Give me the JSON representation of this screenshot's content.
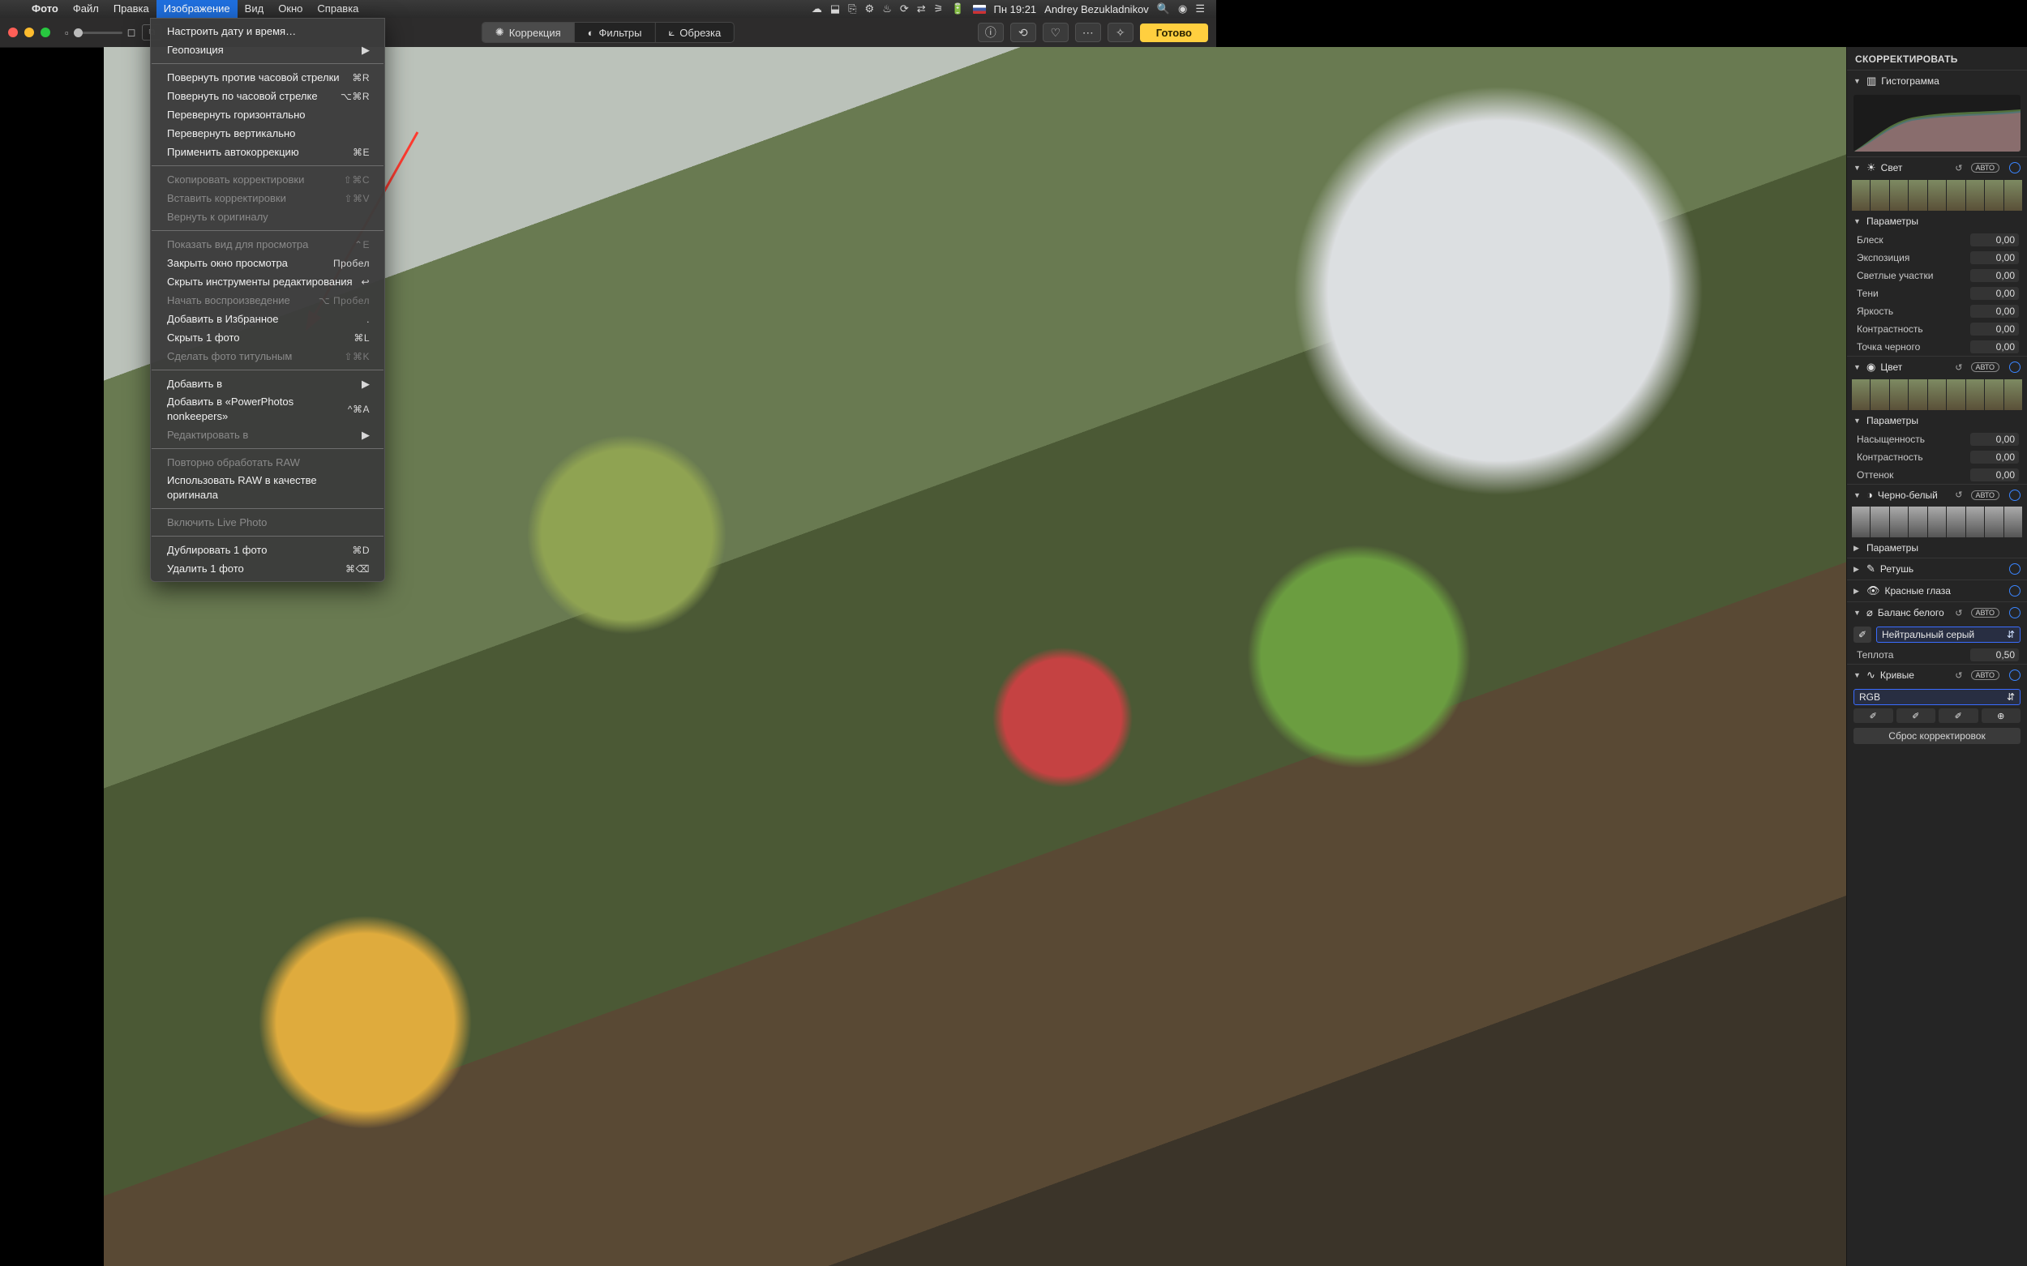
{
  "menubar": {
    "app": "Фото",
    "items": [
      "Файл",
      "Правка",
      "Изображение",
      "Вид",
      "Окно",
      "Справка"
    ],
    "active_index": 2,
    "time": "Пн 19:21",
    "user": "Andrey Bezukladnikov"
  },
  "toolbar": {
    "segments": {
      "adjust": "Коррекция",
      "filters": "Фильтры",
      "crop": "Обрезка"
    },
    "done": "Готово"
  },
  "dropdown": {
    "groups": [
      [
        {
          "label": "Настроить дату и время…",
          "shortcut": "",
          "dis": false
        },
        {
          "label": "Геопозиция",
          "shortcut": "",
          "dis": false,
          "submenu": true
        }
      ],
      [
        {
          "label": "Повернуть против часовой стрелки",
          "shortcut": "⌘R"
        },
        {
          "label": "Повернуть по часовой стрелке",
          "shortcut": "⌥⌘R"
        },
        {
          "label": "Перевернуть горизонтально",
          "shortcut": ""
        },
        {
          "label": "Перевернуть вертикально",
          "shortcut": ""
        },
        {
          "label": "Применить автокоррекцию",
          "shortcut": "⌘E"
        }
      ],
      [
        {
          "label": "Скопировать корректировки",
          "shortcut": "⇧⌘C",
          "dis": true
        },
        {
          "label": "Вставить корректировки",
          "shortcut": "⇧⌘V",
          "dis": true
        },
        {
          "label": "Вернуть к оригиналу",
          "shortcut": "",
          "dis": true
        }
      ],
      [
        {
          "label": "Показать вид для просмотра",
          "shortcut": "⌃E",
          "dis": true
        },
        {
          "label": "Закрыть окно просмотра",
          "shortcut": "Пробел"
        },
        {
          "label": "Скрыть инструменты редактирования",
          "shortcut": "↩"
        },
        {
          "label": "Начать воспроизведение",
          "shortcut": "⌥ Пробел",
          "dis": true
        },
        {
          "label": "Добавить в Избранное",
          "shortcut": "."
        },
        {
          "label": "Скрыть 1 фото",
          "shortcut": "⌘L"
        },
        {
          "label": "Сделать фото титульным",
          "shortcut": "⇧⌘K",
          "dis": true
        }
      ],
      [
        {
          "label": "Добавить в",
          "shortcut": "",
          "submenu": true
        },
        {
          "label": "Добавить в «PowerPhotos nonkeepers»",
          "shortcut": "^⌘A"
        },
        {
          "label": "Редактировать в",
          "shortcut": "",
          "dis": true,
          "submenu": true
        }
      ],
      [
        {
          "label": "Повторно обработать RAW",
          "shortcut": "",
          "dis": true
        },
        {
          "label": "Использовать RAW в качестве оригинала",
          "shortcut": ""
        }
      ],
      [
        {
          "label": "Включить Live Photo",
          "shortcut": "",
          "dis": true
        }
      ],
      [
        {
          "label": "Дублировать 1 фото",
          "shortcut": "⌘D"
        },
        {
          "label": "Удалить 1 фото",
          "shortcut": "⌘⌫"
        }
      ]
    ]
  },
  "side": {
    "title": "СКОРРЕКТИРОВАТЬ",
    "histogram": "Гистограмма",
    "light": {
      "label": "Свет",
      "auto": "АВТО",
      "params_label": "Параметры",
      "params": [
        {
          "l": "Блеск",
          "v": "0,00"
        },
        {
          "l": "Экспозиция",
          "v": "0,00"
        },
        {
          "l": "Светлые участки",
          "v": "0,00"
        },
        {
          "l": "Тени",
          "v": "0,00"
        },
        {
          "l": "Яркость",
          "v": "0,00"
        },
        {
          "l": "Контрастность",
          "v": "0,00"
        },
        {
          "l": "Точка черного",
          "v": "0,00"
        }
      ]
    },
    "color": {
      "label": "Цвет",
      "auto": "АВТО",
      "params_label": "Параметры",
      "params": [
        {
          "l": "Насыщенность",
          "v": "0,00"
        },
        {
          "l": "Контрастность",
          "v": "0,00"
        },
        {
          "l": "Оттенок",
          "v": "0,00"
        }
      ]
    },
    "bw": {
      "label": "Черно-белый",
      "auto": "АВТО",
      "params_label": "Параметры"
    },
    "retouch": "Ретушь",
    "redeye": "Красные глаза",
    "wb": {
      "label": "Баланс белого",
      "auto": "АВТО",
      "mode": "Нейтральный серый",
      "warmth_l": "Теплота",
      "warmth_v": "0,50"
    },
    "curves": {
      "label": "Кривые",
      "auto": "АВТО",
      "channel": "RGB"
    },
    "reset": "Сброс корректировок"
  }
}
